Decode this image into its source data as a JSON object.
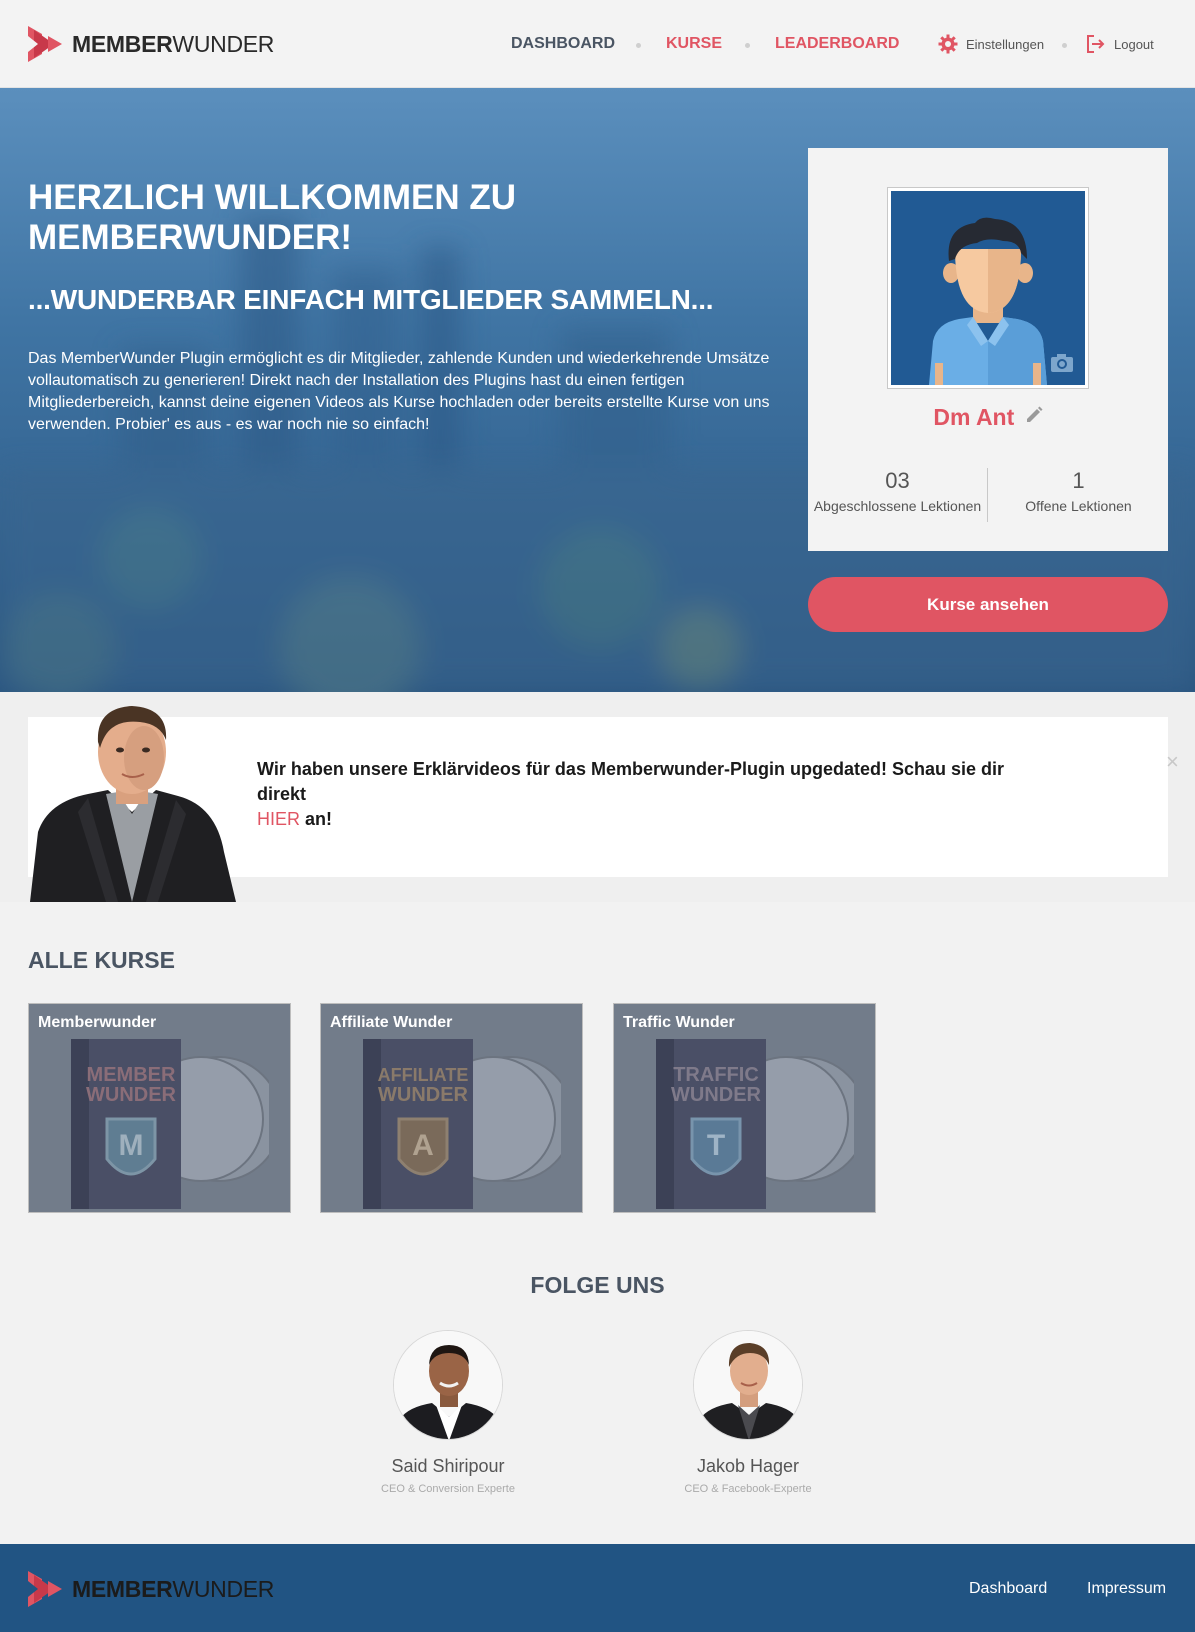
{
  "brand": {
    "name_bold": "MEMBER",
    "name_light": "WUNDER",
    "accent": "#e05563",
    "dark_blue": "#215483"
  },
  "nav": {
    "dashboard": "DASHBOARD",
    "kurse": "KURSE",
    "leaderboard": "LEADERBOARD",
    "settings": "Einstellungen",
    "logout": "Logout"
  },
  "hero": {
    "title": "HERZLICH WILLKOMMEN ZU MEMBERWUNDER!",
    "subtitle": "...WUNDERBAR EINFACH MITGLIEDER SAMMELN...",
    "text": "Das MemberWunder Plugin ermöglicht es dir Mitglieder, zahlende Kunden und wiederkehrende Umsätze vollautomatisch zu generieren! Direkt nach der Installation des Plugins hast du einen fertigen Mitgliederbereich, kannst deine eigenen Videos als Kurse hochladen oder bereits erstellte Kurse von uns verwenden. Probier' es aus - es war noch nie so einfach!"
  },
  "profile": {
    "name": "Dm Ant",
    "completed_count": "03",
    "completed_label": "Abgeschlossene Lektionen",
    "open_count": "1",
    "open_label": "Offene Lektionen",
    "cta": "Kurse ansehen"
  },
  "notice": {
    "text_before": "Wir haben unsere Erklärvideos für das Memberwunder-Plugin upgedated! Schau sie dir direkt",
    "link": "HIER",
    "text_after": "an!",
    "close": "×"
  },
  "courses": {
    "title": "ALLE KURSE",
    "items": [
      {
        "title": "Memberwunder",
        "box_line1": "MEMBER",
        "box_line2": "WUNDER",
        "letter": "M"
      },
      {
        "title": "Affiliate Wunder",
        "box_line1": "AFFILIATE",
        "box_line2": "WUNDER",
        "letter": "A"
      },
      {
        "title": "Traffic Wunder",
        "box_line1": "TRAFFIC",
        "box_line2": "WUNDER",
        "letter": "T"
      }
    ]
  },
  "follow": {
    "title": "FOLGE UNS",
    "people": [
      {
        "name": "Said Shiripour",
        "role": "CEO & Conversion Experte"
      },
      {
        "name": "Jakob Hager",
        "role": "CEO & Facebook-Experte"
      }
    ]
  },
  "footer": {
    "dashboard": "Dashboard",
    "impressum": "Impressum"
  }
}
